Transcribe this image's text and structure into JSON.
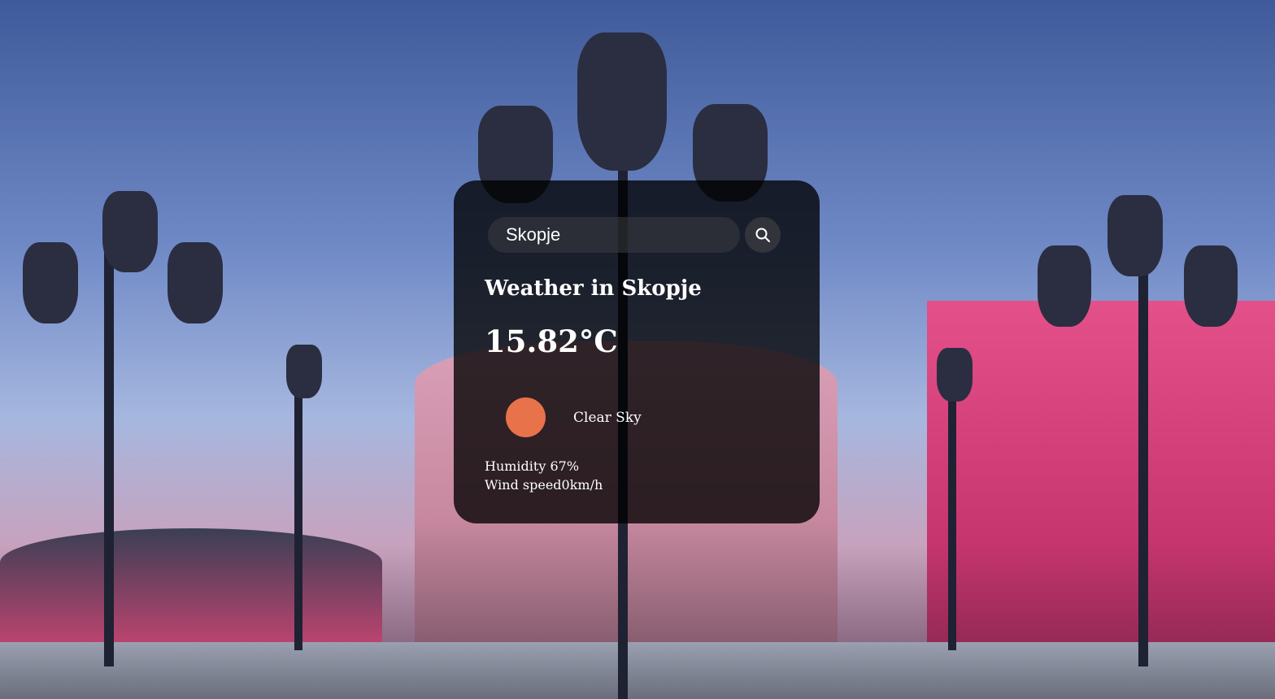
{
  "search": {
    "value": "Skopje",
    "button_icon": "search-icon"
  },
  "weather": {
    "title": "Weather in Skopje",
    "temperature": "15.82°C",
    "icon": "sun-icon",
    "icon_color": "#e8724a",
    "description": "Clear Sky",
    "humidity": "Humidity 67%",
    "wind": "Wind speed0km/h"
  },
  "colors": {
    "card_background": "rgba(0,0,0,0.78)",
    "accent_sun": "#e8724a"
  }
}
